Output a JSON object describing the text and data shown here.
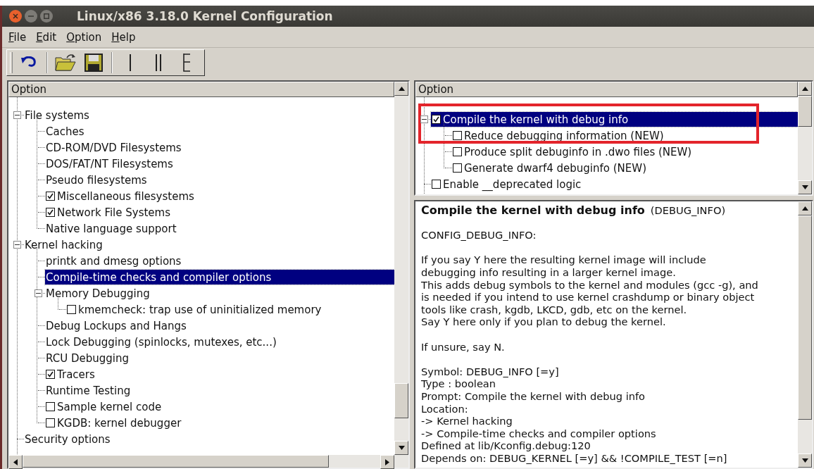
{
  "window": {
    "title": "Linux/x86 3.18.0 Kernel Configuration"
  },
  "menu": [
    {
      "label": "File"
    },
    {
      "label": "Edit"
    },
    {
      "label": "Option"
    },
    {
      "label": "Help"
    }
  ],
  "menu_tree": {
    "header": "Option",
    "items": [
      {
        "label": "File systems",
        "kind": "menu",
        "selected": false,
        "expanded": true,
        "children": [
          {
            "label": "Caches",
            "kind": "menu",
            "selected": false
          },
          {
            "label": "CD-ROM/DVD Filesystems",
            "kind": "menu",
            "selected": false
          },
          {
            "label": "DOS/FAT/NT Filesystems",
            "kind": "menu",
            "selected": false
          },
          {
            "label": "Pseudo filesystems",
            "kind": "menu",
            "selected": false
          },
          {
            "label": "Miscellaneous filesystems",
            "kind": "bool",
            "checked": true,
            "selected": false
          },
          {
            "label": "Network File Systems",
            "kind": "bool",
            "checked": true,
            "selected": false
          },
          {
            "label": "Native language support",
            "kind": "menu",
            "selected": false
          }
        ]
      },
      {
        "label": "Kernel hacking",
        "kind": "menu",
        "selected": false,
        "expanded": true,
        "children": [
          {
            "label": "printk and dmesg options",
            "kind": "menu",
            "selected": false
          },
          {
            "label": "Compile-time checks and compiler options",
            "kind": "menu",
            "selected": true
          },
          {
            "label": "Memory Debugging",
            "kind": "menu",
            "selected": false,
            "expanded": true,
            "children": [
              {
                "label": "kmemcheck: trap use of uninitialized memory",
                "kind": "bool",
                "checked": false,
                "selected": false
              }
            ]
          },
          {
            "label": "Debug Lockups and Hangs",
            "kind": "menu",
            "selected": false
          },
          {
            "label": "Lock Debugging (spinlocks, mutexes, etc...)",
            "kind": "menu",
            "selected": false
          },
          {
            "label": "RCU Debugging",
            "kind": "menu",
            "selected": false
          },
          {
            "label": "Tracers",
            "kind": "bool",
            "checked": true,
            "selected": false
          },
          {
            "label": "Runtime Testing",
            "kind": "menu",
            "selected": false
          },
          {
            "label": "Sample kernel code",
            "kind": "bool",
            "checked": false,
            "selected": false
          },
          {
            "label": "KGDB: kernel debugger",
            "kind": "bool",
            "checked": false,
            "selected": false
          }
        ]
      },
      {
        "label": "Security options",
        "kind": "menu",
        "selected": false
      }
    ]
  },
  "option_tree": {
    "header": "Option",
    "items": [
      {
        "label": "Compile the kernel with debug info",
        "kind": "bool",
        "checked": true,
        "selected": true,
        "expanded": true,
        "children": [
          {
            "label": "Reduce debugging information (NEW)",
            "kind": "bool",
            "checked": false,
            "selected": false
          },
          {
            "label": "Produce split debuginfo in .dwo files (NEW)",
            "kind": "bool",
            "checked": false,
            "selected": false
          },
          {
            "label": "Generate dwarf4 debuginfo (NEW)",
            "kind": "bool",
            "checked": false,
            "selected": false
          }
        ]
      },
      {
        "label": "Enable __deprecated logic",
        "kind": "bool",
        "checked": false,
        "selected": false
      }
    ]
  },
  "help": {
    "title": "Compile the kernel with debug info",
    "symbol": "(DEBUG_INFO)",
    "paragraphs": [
      [
        "CONFIG_DEBUG_INFO:"
      ],
      [
        "If you say Y here the resulting kernel image will include",
        "debugging info resulting in a larger kernel image.",
        "This adds debug symbols to the kernel and modules (gcc -g), and",
        "is needed if you intend to use kernel crashdump or binary object",
        "tools like crash, kgdb, LKCD, gdb, etc on the kernel.",
        "Say Y here only if you plan to debug the kernel."
      ],
      [
        "If unsure, say N."
      ],
      [
        "Symbol: DEBUG_INFO [=y]",
        "Type : boolean",
        "Prompt: Compile the kernel with debug info",
        "Location:",
        "-> Kernel hacking",
        "-> Compile-time checks and compiler options",
        "Defined at lib/Kconfig.debug:120",
        "Depends on: DEBUG_KERNEL [=y] && !COMPILE_TEST [=n]"
      ]
    ]
  }
}
